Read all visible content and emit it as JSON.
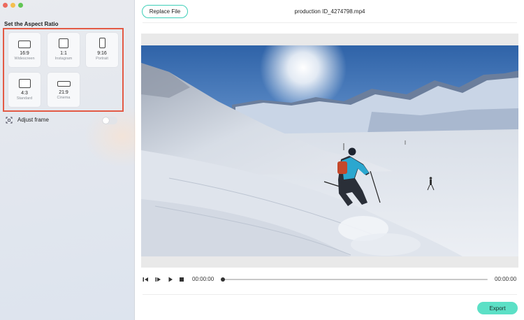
{
  "sidebar": {
    "section_title": "Set the Aspect Ratio",
    "ratios": [
      {
        "value": "16:9",
        "name": "Widescreen"
      },
      {
        "value": "1:1",
        "name": "Instagram"
      },
      {
        "value": "9:16",
        "name": "Portrait"
      },
      {
        "value": "4:3",
        "name": "Standard"
      },
      {
        "value": "21:9",
        "name": "Cinema"
      }
    ],
    "adjust_frame_label": "Adjust frame",
    "adjust_frame_enabled": false
  },
  "header": {
    "replace_label": "Replace File",
    "file_name": "production ID_4274798.mp4"
  },
  "player": {
    "current_time": "00:00:00",
    "total_time": "00:00:00",
    "progress": 0
  },
  "footer": {
    "export_label": "Export"
  },
  "colors": {
    "accent": "#3ecfb8",
    "export_bg": "#5ce0c6",
    "highlight_border": "#e35a45"
  }
}
